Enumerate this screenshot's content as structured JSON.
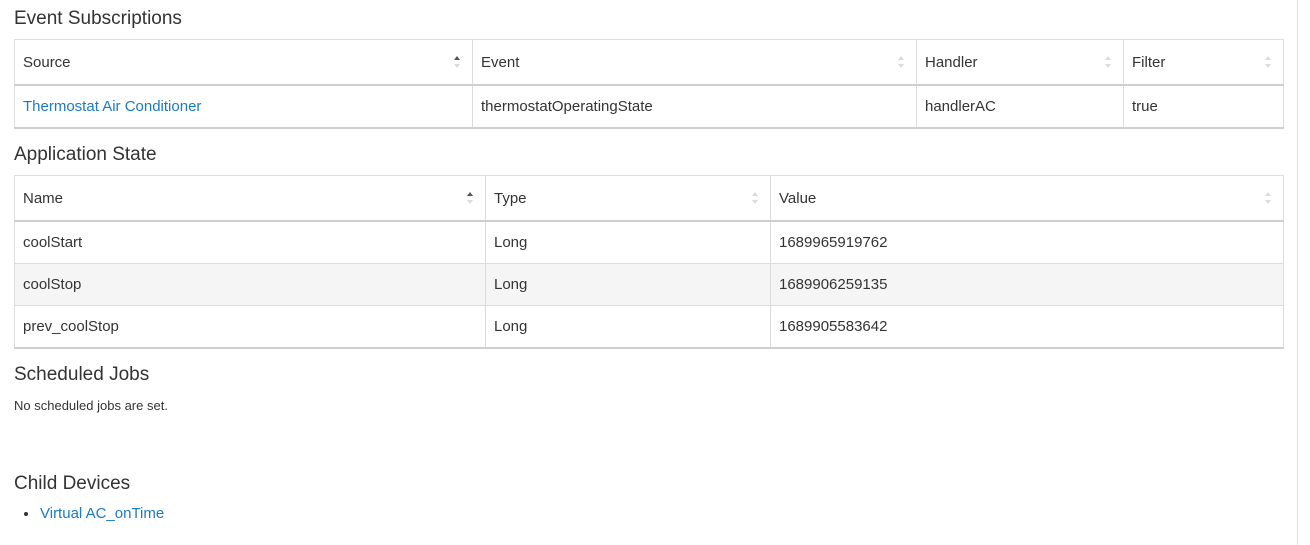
{
  "event_subscriptions": {
    "title": "Event Subscriptions",
    "columns": [
      "Source",
      "Event",
      "Handler",
      "Filter"
    ],
    "rows": [
      {
        "source": "Thermostat Air Conditioner",
        "event": "thermostatOperatingState",
        "handler": "handlerAC",
        "filter": "true"
      }
    ]
  },
  "application_state": {
    "title": "Application State",
    "columns": [
      "Name",
      "Type",
      "Value"
    ],
    "rows": [
      {
        "name": "coolStart",
        "type": "Long",
        "value": "1689965919762"
      },
      {
        "name": "coolStop",
        "type": "Long",
        "value": "1689906259135"
      },
      {
        "name": "prev_coolStop",
        "type": "Long",
        "value": "1689905583642"
      }
    ]
  },
  "scheduled_jobs": {
    "title": "Scheduled Jobs",
    "empty_message": "No scheduled jobs are set."
  },
  "child_devices": {
    "title": "Child Devices",
    "items": [
      "Virtual AC_onTime"
    ]
  },
  "colors": {
    "link": "#1a7bc4",
    "text": "#333333",
    "border": "#dddddd",
    "row_shade": "#f5f5f5"
  }
}
